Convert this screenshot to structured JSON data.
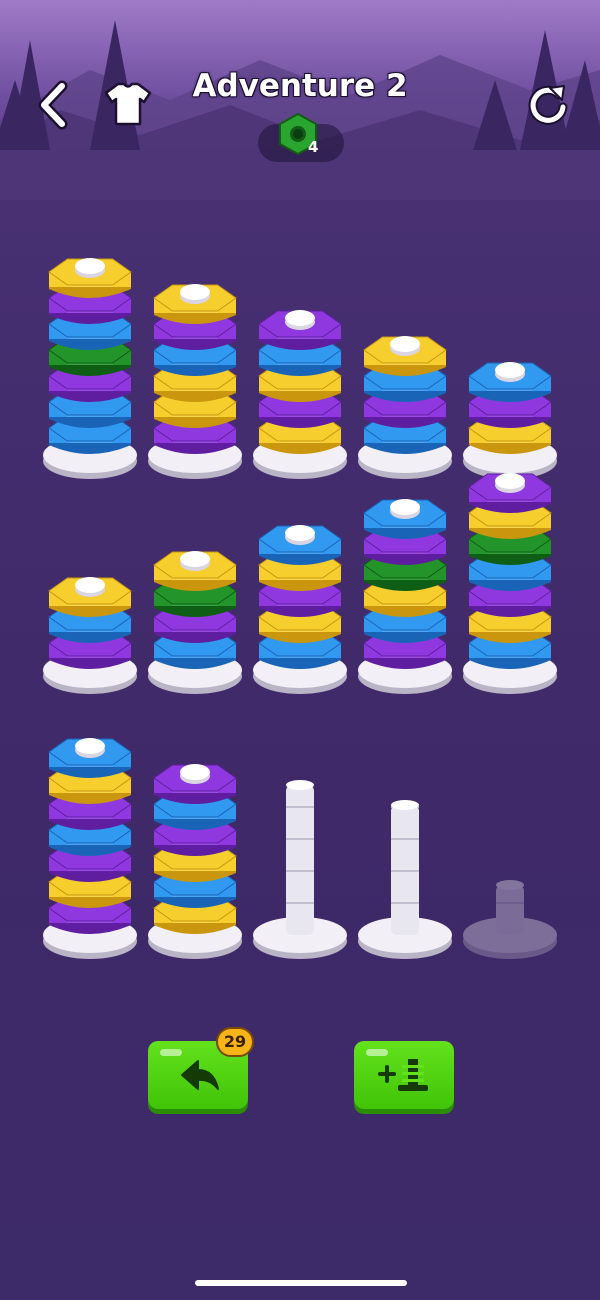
{
  "header": {
    "title": "Adventure 2",
    "currency_count": "4",
    "back_icon": "chevron-left-icon",
    "shirt_icon": "shirt-icon",
    "restart_icon": "restart-icon",
    "currency_icon": "hex-nut-icon"
  },
  "colors": {
    "yellow": "#f3c41d",
    "purple": "#8a33d6",
    "blue": "#2f95ee",
    "green": "#1f8f26",
    "accent_green": "#4fd010",
    "badge": "#f7b419"
  },
  "poles": [
    {
      "nuts": [
        "yellow",
        "purple",
        "blue",
        "green",
        "purple",
        "blue",
        "blue"
      ]
    },
    {
      "nuts": [
        "yellow",
        "purple",
        "blue",
        "yellow",
        "yellow",
        "purple"
      ]
    },
    {
      "nuts": [
        "purple",
        "blue",
        "yellow",
        "purple",
        "yellow"
      ]
    },
    {
      "nuts": [
        "yellow",
        "blue",
        "purple",
        "blue"
      ]
    },
    {
      "nuts": [
        "blue",
        "purple",
        "yellow"
      ]
    },
    {
      "nuts": [
        "yellow",
        "blue",
        "purple"
      ]
    },
    {
      "nuts": [
        "yellow",
        "green",
        "purple",
        "blue"
      ]
    },
    {
      "nuts": [
        "blue",
        "yellow",
        "purple",
        "yellow",
        "blue"
      ]
    },
    {
      "nuts": [
        "blue",
        "purple",
        "green",
        "yellow",
        "blue",
        "purple"
      ]
    },
    {
      "nuts": [
        "purple",
        "yellow",
        "green",
        "blue",
        "purple",
        "yellow",
        "blue"
      ]
    },
    {
      "nuts": [
        "blue",
        "yellow",
        "purple",
        "blue",
        "purple",
        "yellow",
        "purple"
      ]
    },
    {
      "nuts": [
        "purple",
        "blue",
        "purple",
        "yellow",
        "blue",
        "yellow"
      ]
    },
    {
      "nuts": []
    },
    {
      "nuts": []
    },
    {
      "nuts": [],
      "locked": true
    }
  ],
  "actions": {
    "undo_count": "29",
    "undo_icon": "undo-arrow-icon",
    "add_pole_icon": "add-pole-icon"
  }
}
